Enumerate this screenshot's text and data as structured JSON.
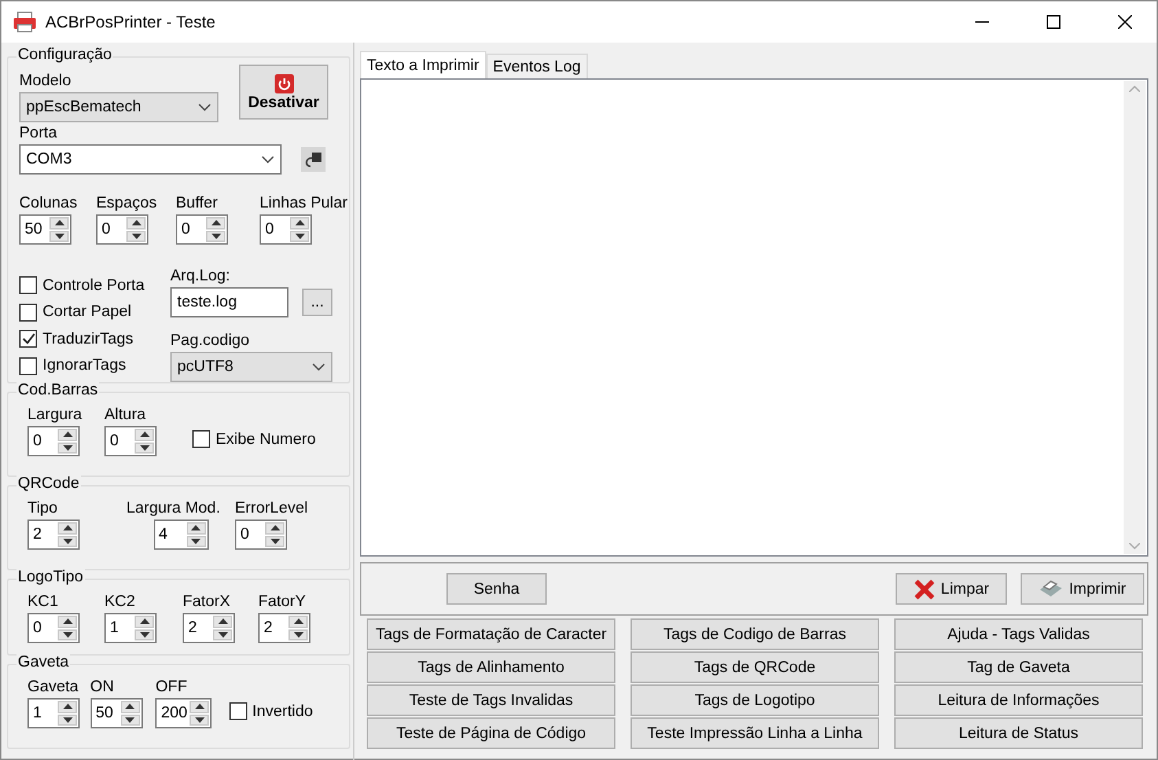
{
  "window": {
    "title": "ACBrPosPrinter - Teste"
  },
  "config": {
    "legend": "Configuração",
    "modelo": {
      "label": "Modelo",
      "value": "ppEscBematech"
    },
    "desativar": "Desativar",
    "porta": {
      "label": "Porta",
      "value": "COM3"
    },
    "spins": [
      {
        "label": "Colunas",
        "value": "50"
      },
      {
        "label": "Espaços",
        "value": "0"
      },
      {
        "label": "Buffer",
        "value": "0"
      },
      {
        "label": "Linhas Pular",
        "value": "0"
      }
    ],
    "checks": [
      {
        "label": "Controle Porta",
        "checked": false
      },
      {
        "label": "Cortar Papel",
        "checked": false
      },
      {
        "label": "TraduzirTags",
        "checked": true
      },
      {
        "label": "IgnorarTags",
        "checked": false
      }
    ],
    "arq_log": {
      "label": "Arq.Log:",
      "value": "teste.log",
      "browse": "..."
    },
    "pag_codigo": {
      "label": "Pag.codigo",
      "value": "pcUTF8"
    }
  },
  "groups": [
    {
      "legend": "Cod.Barras",
      "spins": [
        {
          "label": "Largura",
          "value": "0"
        },
        {
          "label": "Altura",
          "value": "0"
        }
      ],
      "check": {
        "label": "Exibe Numero",
        "checked": false
      }
    },
    {
      "legend": "QRCode",
      "spins": [
        {
          "label": "Tipo",
          "value": "2"
        },
        {
          "label": "Largura Mod.",
          "value": "4"
        },
        {
          "label": "ErrorLevel",
          "value": "0"
        }
      ]
    },
    {
      "legend": "LogoTipo",
      "spins": [
        {
          "label": "KC1",
          "value": "0"
        },
        {
          "label": "KC2",
          "value": "1"
        },
        {
          "label": "FatorX",
          "value": "2"
        },
        {
          "label": "FatorY",
          "value": "2"
        }
      ]
    },
    {
      "legend": "Gaveta",
      "spins": [
        {
          "label": "Gaveta",
          "value": "1"
        },
        {
          "label": "ON",
          "value": "50"
        },
        {
          "label": "OFF",
          "value": "200"
        }
      ],
      "check": {
        "label": "Invertido",
        "checked": false
      }
    }
  ],
  "tabs": [
    {
      "label": "Texto a Imprimir",
      "selected": true
    },
    {
      "label": "Eventos Log",
      "selected": false
    }
  ],
  "actions": {
    "senha": "Senha",
    "limpar": "Limpar",
    "imprimir": "Imprimir"
  },
  "buttons": [
    "Tags de Formatação de Caracter",
    "Tags de Codigo de Barras",
    "Ajuda - Tags Validas",
    "Tags de Alinhamento",
    "Tags de QRCode",
    "Tag de Gaveta",
    "Teste de Tags Invalidas",
    "Tags de Logotipo",
    "Leitura de Informações",
    "Teste de Página de Código",
    "Teste Impressão Linha a Linha",
    "Leitura de Status"
  ]
}
